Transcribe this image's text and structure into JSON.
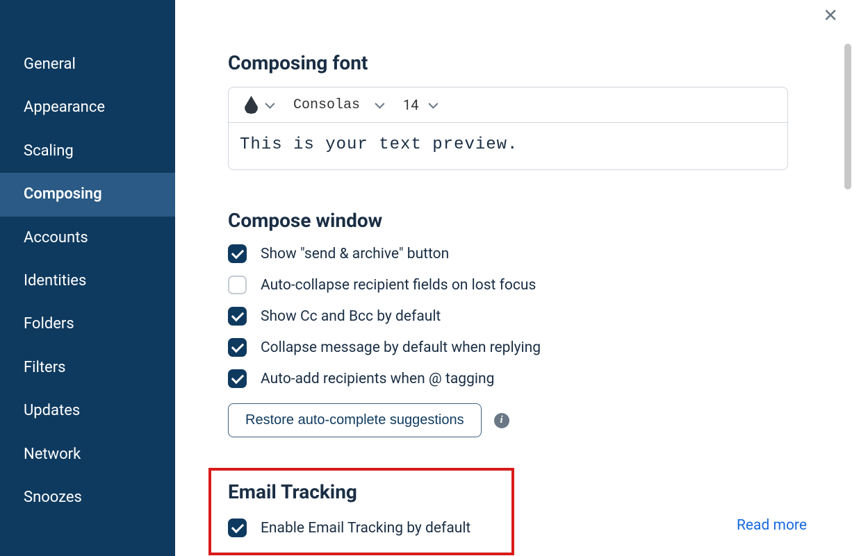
{
  "sidebar": {
    "items": [
      {
        "label": "General"
      },
      {
        "label": "Appearance"
      },
      {
        "label": "Scaling"
      },
      {
        "label": "Composing"
      },
      {
        "label": "Accounts"
      },
      {
        "label": "Identities"
      },
      {
        "label": "Folders"
      },
      {
        "label": "Filters"
      },
      {
        "label": "Updates"
      },
      {
        "label": "Network"
      },
      {
        "label": "Snoozes"
      }
    ],
    "active_index": 3
  },
  "composing_font": {
    "title": "Composing font",
    "font_name": "Consolas",
    "font_size": "14",
    "preview": "This is your text preview."
  },
  "compose_window": {
    "title": "Compose window",
    "options": [
      {
        "label": "Show \"send & archive\" button",
        "checked": true
      },
      {
        "label": "Auto-collapse recipient fields on lost focus",
        "checked": false
      },
      {
        "label": "Show Cc and Bcc by default",
        "checked": true
      },
      {
        "label": "Collapse message by default when replying",
        "checked": true
      },
      {
        "label": "Auto-add recipients when @ tagging",
        "checked": true
      }
    ],
    "restore_button": "Restore auto-complete suggestions"
  },
  "email_tracking": {
    "title": "Email Tracking",
    "option": {
      "label": "Enable Email Tracking by default",
      "checked": true
    },
    "read_more": "Read more"
  }
}
